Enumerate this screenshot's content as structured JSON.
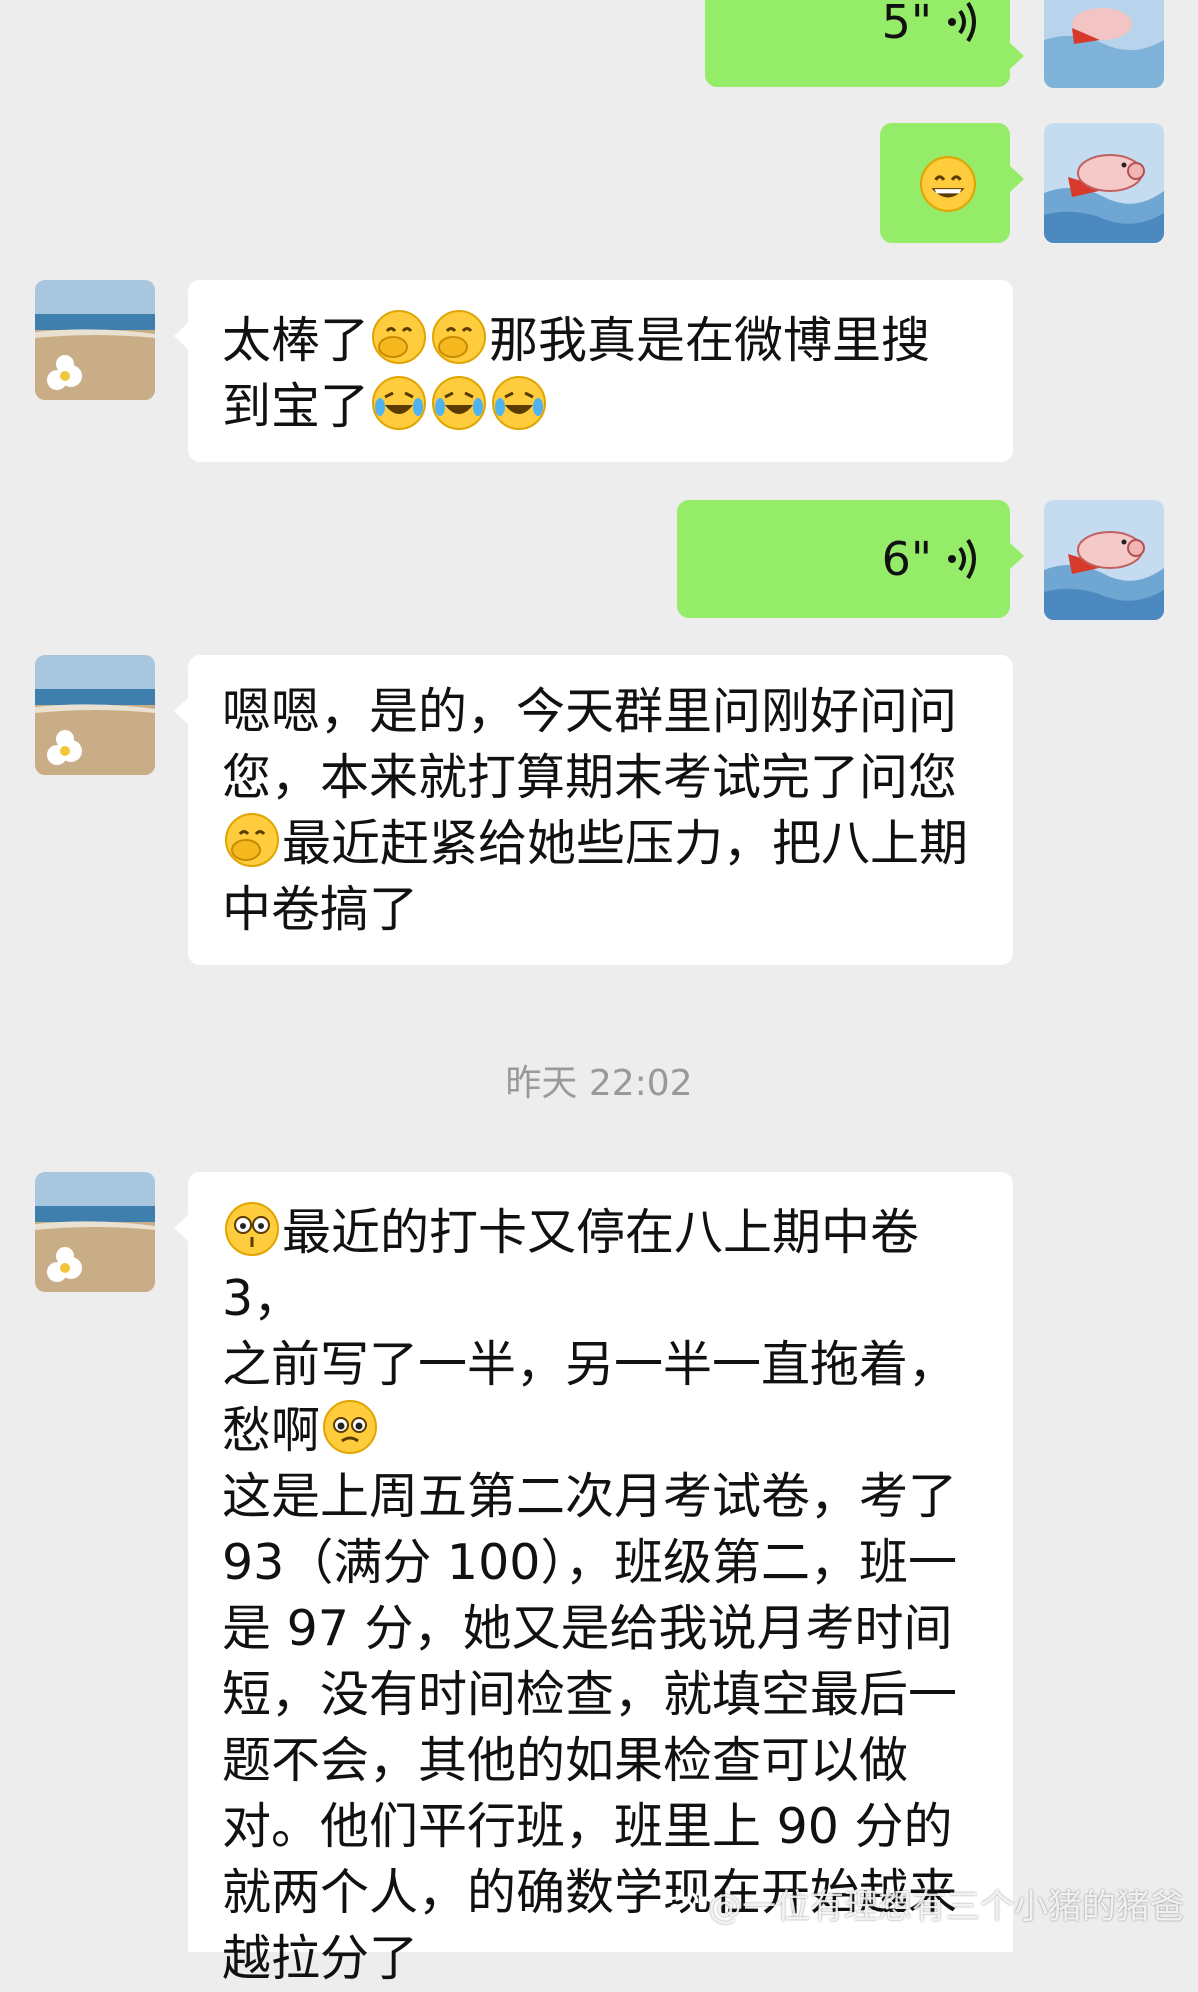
{
  "colors": {
    "background": "#ededed",
    "incoming_bubble": "#ffffff",
    "outgoing_bubble": "#95ec69",
    "timestamp_text": "#999999"
  },
  "messages": [
    {
      "side": "out",
      "type": "voice",
      "duration": "5\"",
      "avatar": "flying-pig-avatar"
    },
    {
      "side": "out",
      "type": "emoji",
      "emoji": "grinning-face-emoji",
      "avatar": "flying-pig-avatar"
    },
    {
      "side": "in",
      "type": "text",
      "avatar": "beach-flower-avatar",
      "lines": [
        "太棒了",
        "那我真是在微博里搜",
        "到宝了"
      ],
      "emojis": [
        "face-with-hand-over-mouth-emoji",
        "face-with-hand-over-mouth-emoji",
        "tears-of-joy-emoji",
        "tears-of-joy-emoji",
        "tears-of-joy-emoji"
      ]
    },
    {
      "side": "out",
      "type": "voice",
      "duration": "6\"",
      "avatar": "flying-pig-avatar"
    },
    {
      "side": "in",
      "type": "text",
      "avatar": "beach-flower-avatar",
      "lines": [
        "嗯嗯，是的，今天群里问刚好问问",
        "您，本来就打算期末考试完了问您",
        "最近赶紧给她些压力，把八上期",
        "中卷搞了"
      ],
      "emojis": [
        "face-with-hand-over-mouth-emoji"
      ]
    },
    {
      "side": "in",
      "type": "text",
      "avatar": "beach-flower-avatar",
      "lines": [
        "最近的打卡又停在八上期中卷 3，",
        "之前写了一半，另一半一直拖着，",
        "愁啊",
        "这是上周五第二次月考试卷，考了",
        "93（满分 100），班级第二，班一",
        "是 97 分，她又是给我说月考时间",
        "短，没有时间检查，就填空最后一",
        "题不会，其他的如果检查可以做",
        "对。他们平行班，班里上 90 分的",
        "就两个人，的确数学现在开始越来",
        "越拉分了"
      ],
      "emojis": [
        "worried-eyes-emoji",
        "pleading-face-emoji"
      ]
    }
  ],
  "timestamp": "昨天 22:02",
  "watermark": "@一位有理想有三个小猪的猪爸"
}
